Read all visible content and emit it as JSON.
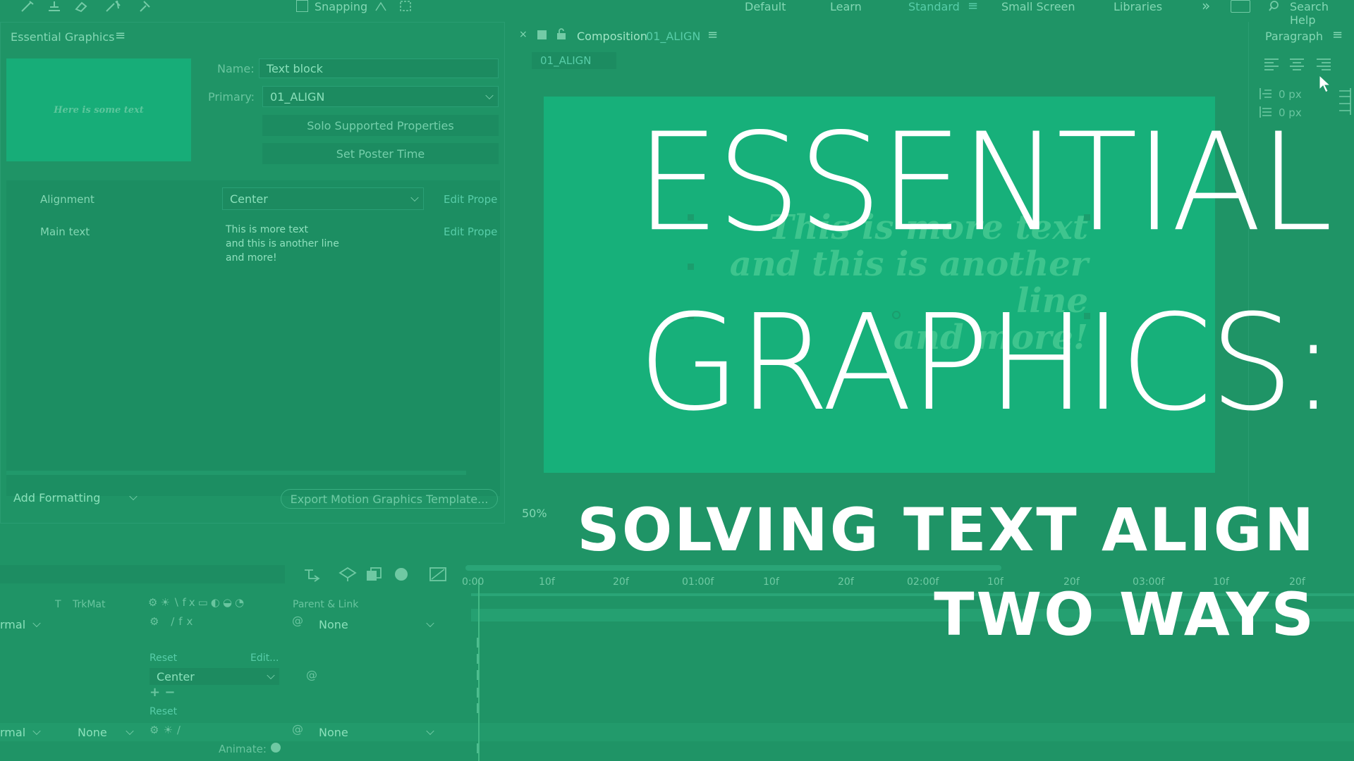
{
  "toolbar": {
    "snapping_label": "Snapping",
    "workspaces": [
      "Default",
      "Learn",
      "Standard",
      "Small Screen",
      "Libraries"
    ],
    "more_label": "»",
    "search_label": "Search Help"
  },
  "eg_panel": {
    "title": "Essential Graphics",
    "thumbnail_text": "Here is some text",
    "name_label": "Name:",
    "name_value": "Text block",
    "primary_label": "Primary:",
    "primary_value": "01_ALIGN",
    "solo_button": "Solo Supported Properties",
    "poster_button": "Set Poster Time",
    "alignment_label": "Alignment",
    "alignment_value": "Center",
    "edit_props_1": "Edit Prope",
    "main_text_label": "Main text",
    "main_text_lines": [
      "This is more text",
      "and this is another line",
      "and more!"
    ],
    "edit_props_2": "Edit Prope",
    "add_formatting": "Add Formatting",
    "export_button": "Export Motion Graphics Template..."
  },
  "comp_panel": {
    "title_prefix": "Composition",
    "comp_name": "01_ALIGN",
    "tab_label": "01_ALIGN",
    "zoom": "50%",
    "canvas_lines": [
      "This is more text",
      "and this is another line",
      "and more!"
    ]
  },
  "paragraph_panel": {
    "title": "Paragraph",
    "indent_1": "0 px",
    "indent_2": "0 px"
  },
  "timeline": {
    "trkmat_label": "TrkMat",
    "t_label": "T",
    "parent_link_label": "Parent & Link",
    "mode_1": "rmal",
    "parent_1": "None",
    "reset_1": "Reset",
    "edit_label": "Edit...",
    "center_value": "Center",
    "reset_2": "Reset",
    "mode_2": "rmal",
    "trkmat_2": "None",
    "parent_2": "None",
    "animate_label": "Animate:",
    "ruler": [
      "0:00",
      "10f",
      "20f",
      "01:00f",
      "10f",
      "20f",
      "02:00f",
      "10f",
      "20f",
      "03:00f",
      "10f",
      "20f"
    ]
  },
  "overlay": {
    "title_line_1": "ESSENTIAL",
    "title_line_2": "GRAPHICS:",
    "subtitle_line_1": "SOLVING TEXT ALIGN",
    "subtitle_line_2": "TWO WAYS"
  },
  "colors": {
    "background": "#1f9466",
    "canvas": "#17b07a",
    "title_white": "#ffffff"
  }
}
